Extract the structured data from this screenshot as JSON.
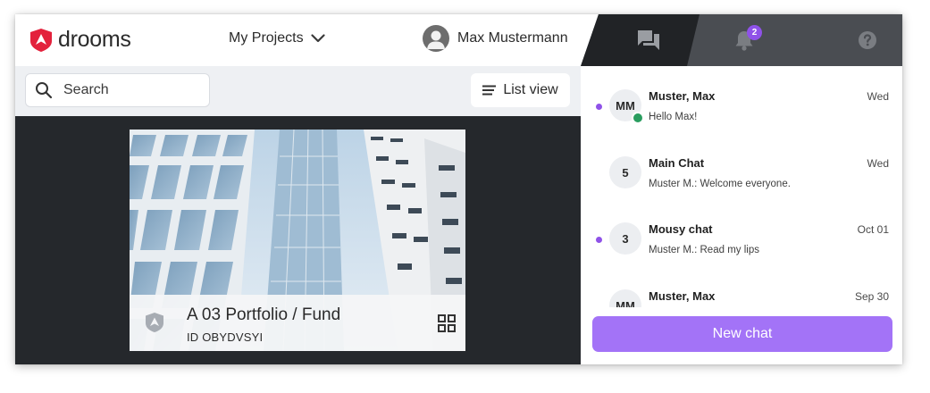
{
  "app": {
    "brand": "drooms"
  },
  "header": {
    "projects_label": "My Projects",
    "user_name": "Max Mustermann"
  },
  "toolbar": {
    "search_placeholder": "Search",
    "list_view_label": "List view"
  },
  "project_card": {
    "title": "A 03 Portfolio / Fund",
    "id_text": "ID OBYDVSYI"
  },
  "panel": {
    "tabs": [
      {
        "name": "chat",
        "icon": "chat-icon",
        "active": true
      },
      {
        "name": "notifications",
        "icon": "bell-icon",
        "badge": "2"
      },
      {
        "name": "help",
        "icon": "help-icon"
      }
    ],
    "chats": [
      {
        "avatar": "MM",
        "name": "Muster, Max",
        "date": "Wed",
        "preview": "Hello Max!",
        "unread": true,
        "online": true
      },
      {
        "avatar": "5",
        "name": "Main Chat",
        "date": "Wed",
        "preview": "Muster M.: Welcome everyone.",
        "unread": false,
        "online": false
      },
      {
        "avatar": "3",
        "name": "Mousy chat",
        "date": "Oct 01",
        "preview": "Muster M.: Read my lips",
        "unread": true,
        "online": false
      },
      {
        "avatar": "MM",
        "name": "Muster, Max",
        "date": "Sep 30",
        "preview": "",
        "unread": false,
        "online": false
      }
    ],
    "new_chat_label": "New chat"
  },
  "colors": {
    "accent": "#a373f7",
    "unread": "#8f52e8",
    "online": "#2a9d5f",
    "brand_red": "#e3213c",
    "dark_bg": "#25282c"
  }
}
